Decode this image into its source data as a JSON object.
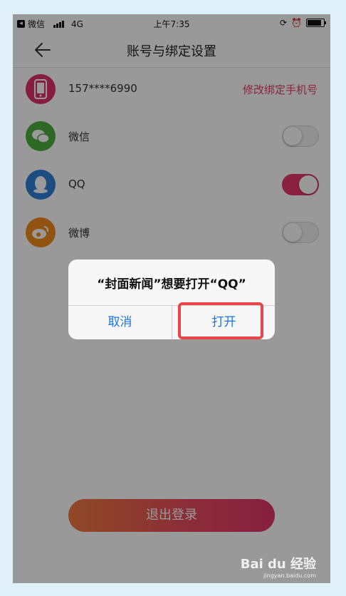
{
  "status": {
    "app": "微信",
    "network": "4G",
    "time": "上午7:35"
  },
  "nav": {
    "title": "账号与绑定设置"
  },
  "rows": [
    {
      "label": "157****6990",
      "action": "修改绑定手机号",
      "icon": "phone-icon",
      "color": "#e0306a"
    },
    {
      "label": "微信",
      "toggle": "off",
      "icon": "wechat-icon",
      "color": "#4caf3f"
    },
    {
      "label": "QQ",
      "toggle": "on",
      "icon": "qq-icon",
      "color": "#2f80d8"
    },
    {
      "label": "微博",
      "toggle": "off",
      "icon": "weibo-icon",
      "color": "#f08a1c"
    }
  ],
  "logout": {
    "label": "退出登录"
  },
  "dialog": {
    "message": "“封面新闻”想要打开“QQ”",
    "cancel": "取消",
    "open": "打开"
  },
  "watermark": {
    "brand": "Bai du 经验",
    "url": "jingyan.baidu.com"
  },
  "colors": {
    "accent": "#e8386b",
    "dialog_button": "#1a73e8",
    "highlight": "#e8464a"
  }
}
